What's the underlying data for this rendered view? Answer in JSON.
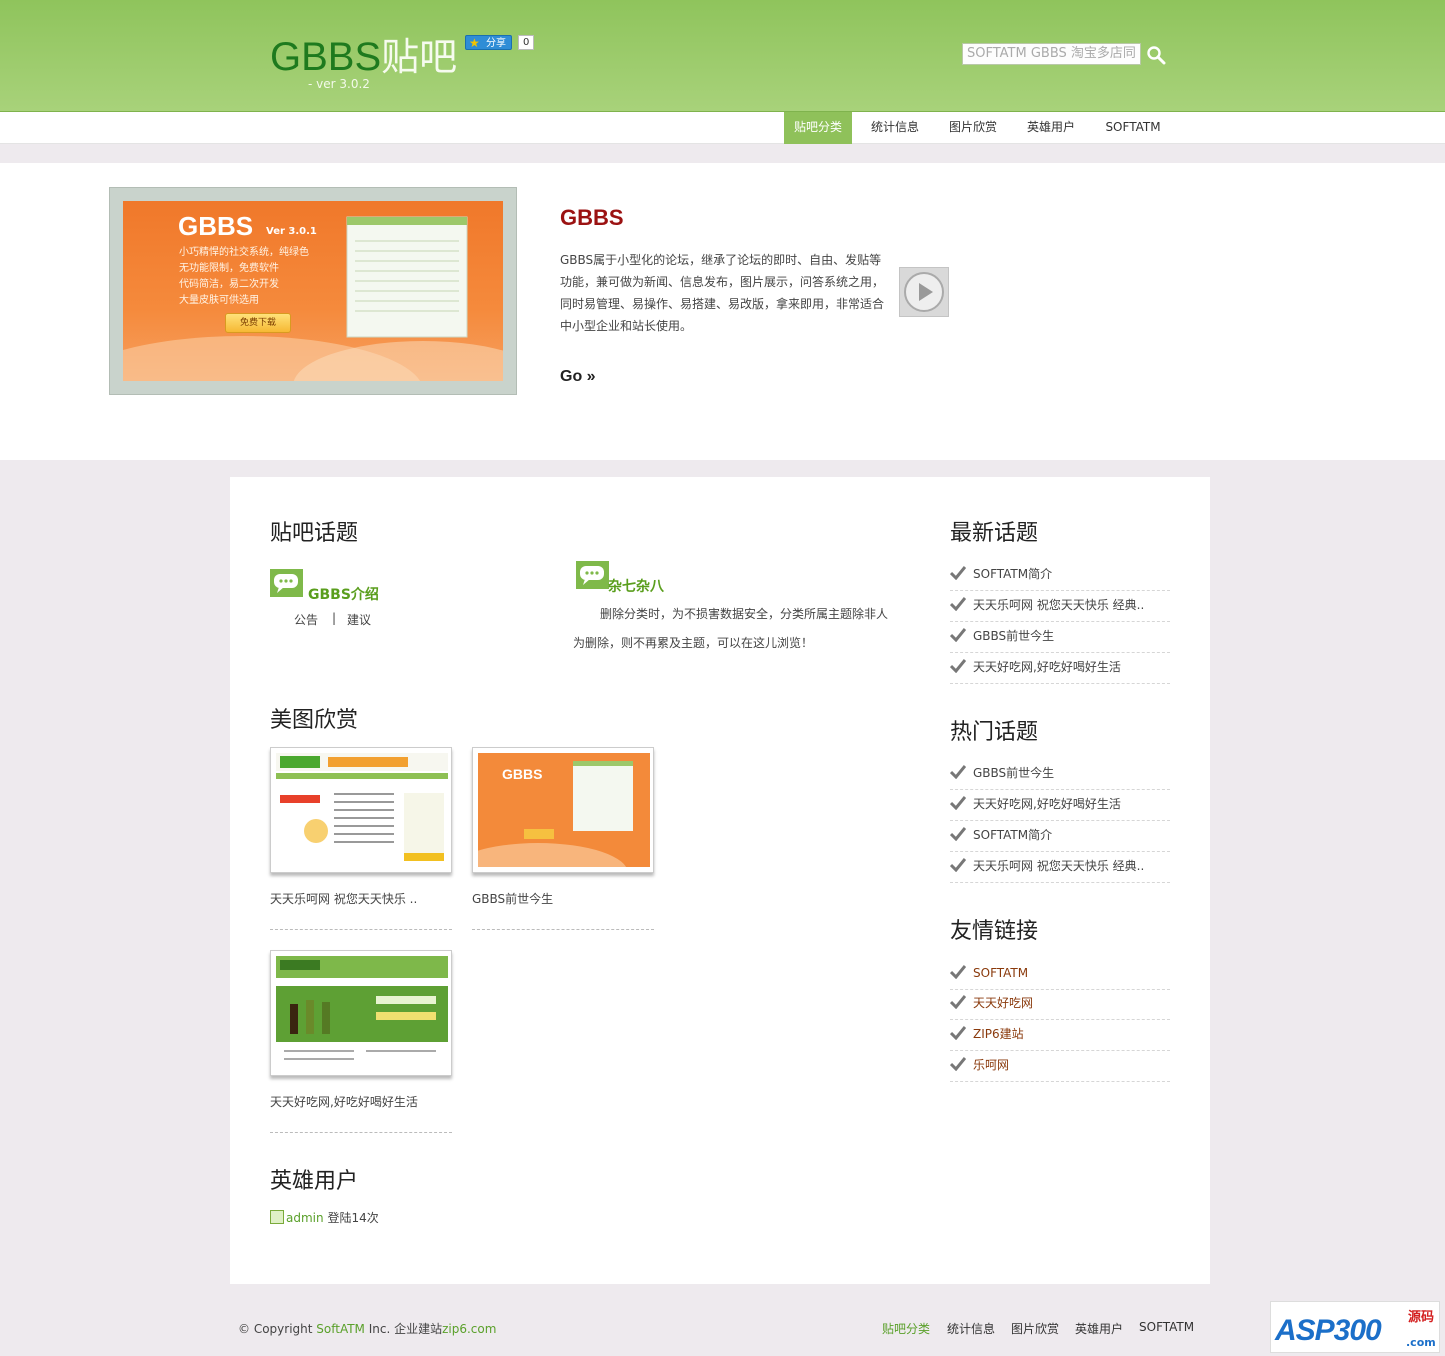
{
  "header": {
    "logo_latin": "GBBS",
    "logo_cn": "贴吧",
    "version": "- ver 3.0.2",
    "share_label": "分享",
    "share_count": "0",
    "search_placeholder": "SOFTATM GBBS 淘宝多店同"
  },
  "nav": {
    "items": [
      "贴吧分类",
      "统计信息",
      "图片欣赏",
      "英雄用户",
      "SOFTATM"
    ],
    "active": "贴吧分类"
  },
  "hero": {
    "title": "GBBS",
    "desc": "GBBS属于小型化的论坛，继承了论坛的即时、自由、发贴等功能，兼可做为新闻、信息发布，图片展示，问答系统之用，同时易管理、易操作、易搭建、易改版，拿来即用，非常适合中小型企业和站长使用。",
    "go": "Go »",
    "image": {
      "logo": "GBBS",
      "version": "Ver 3.0.1",
      "lines": [
        "小巧精悍的社交系统，纯绿色",
        "无功能限制，免费软件",
        "代码简洁，易二次开发",
        "大量皮肤可供选用"
      ],
      "button": "免费下载"
    }
  },
  "topics": {
    "heading": "贴吧话题",
    "categories": [
      {
        "name": "GBBS介绍",
        "subs": [
          "公告",
          "建议"
        ],
        "separator": "|"
      },
      {
        "name": "杂七杂八",
        "desc": "删除分类时，为不损害数据安全，分类所属主题除非人为删除，则不再累及主题，可以在这儿浏览！"
      }
    ]
  },
  "gallery": {
    "heading": "美图欣赏",
    "items": [
      {
        "caption": "天天乐呵网 祝您天天快乐 .."
      },
      {
        "caption": "GBBS前世今生"
      },
      {
        "caption": "天天好吃网,好吃好喝好生活"
      }
    ]
  },
  "heroes": {
    "heading": "英雄用户",
    "user": "admin",
    "logins": "登陆14次"
  },
  "sidebar": {
    "latest": {
      "heading": "最新话题",
      "items": [
        "SOFTATM简介",
        "天天乐呵网 祝您天天快乐 经典..",
        "GBBS前世今生",
        "天天好吃网,好吃好喝好生活"
      ]
    },
    "hot": {
      "heading": "热门话题",
      "items": [
        "GBBS前世今生",
        "天天好吃网,好吃好喝好生活",
        "SOFTATM简介",
        "天天乐呵网 祝您天天快乐 经典.."
      ]
    },
    "links": {
      "heading": "友情链接",
      "items": [
        "SOFTATM",
        "天天好吃网",
        "ZIP6建站",
        "乐呵网"
      ]
    }
  },
  "footer": {
    "copy_prefix": "© Copyright ",
    "brand": "SoftATM",
    "copy_mid": " Inc. 企业建站",
    "site": "zip6.com",
    "nav": [
      "贴吧分类",
      "统计信息",
      "图片欣赏",
      "英雄用户",
      "SOFTATM"
    ]
  },
  "watermark": {
    "text": "ASP300",
    "sub": "源码",
    "domain": ".com"
  },
  "colors": {
    "header_green": "#8fc45c",
    "accent": "#5aa02a",
    "hero_title": "#9b1212",
    "orange": "#f0782a"
  }
}
